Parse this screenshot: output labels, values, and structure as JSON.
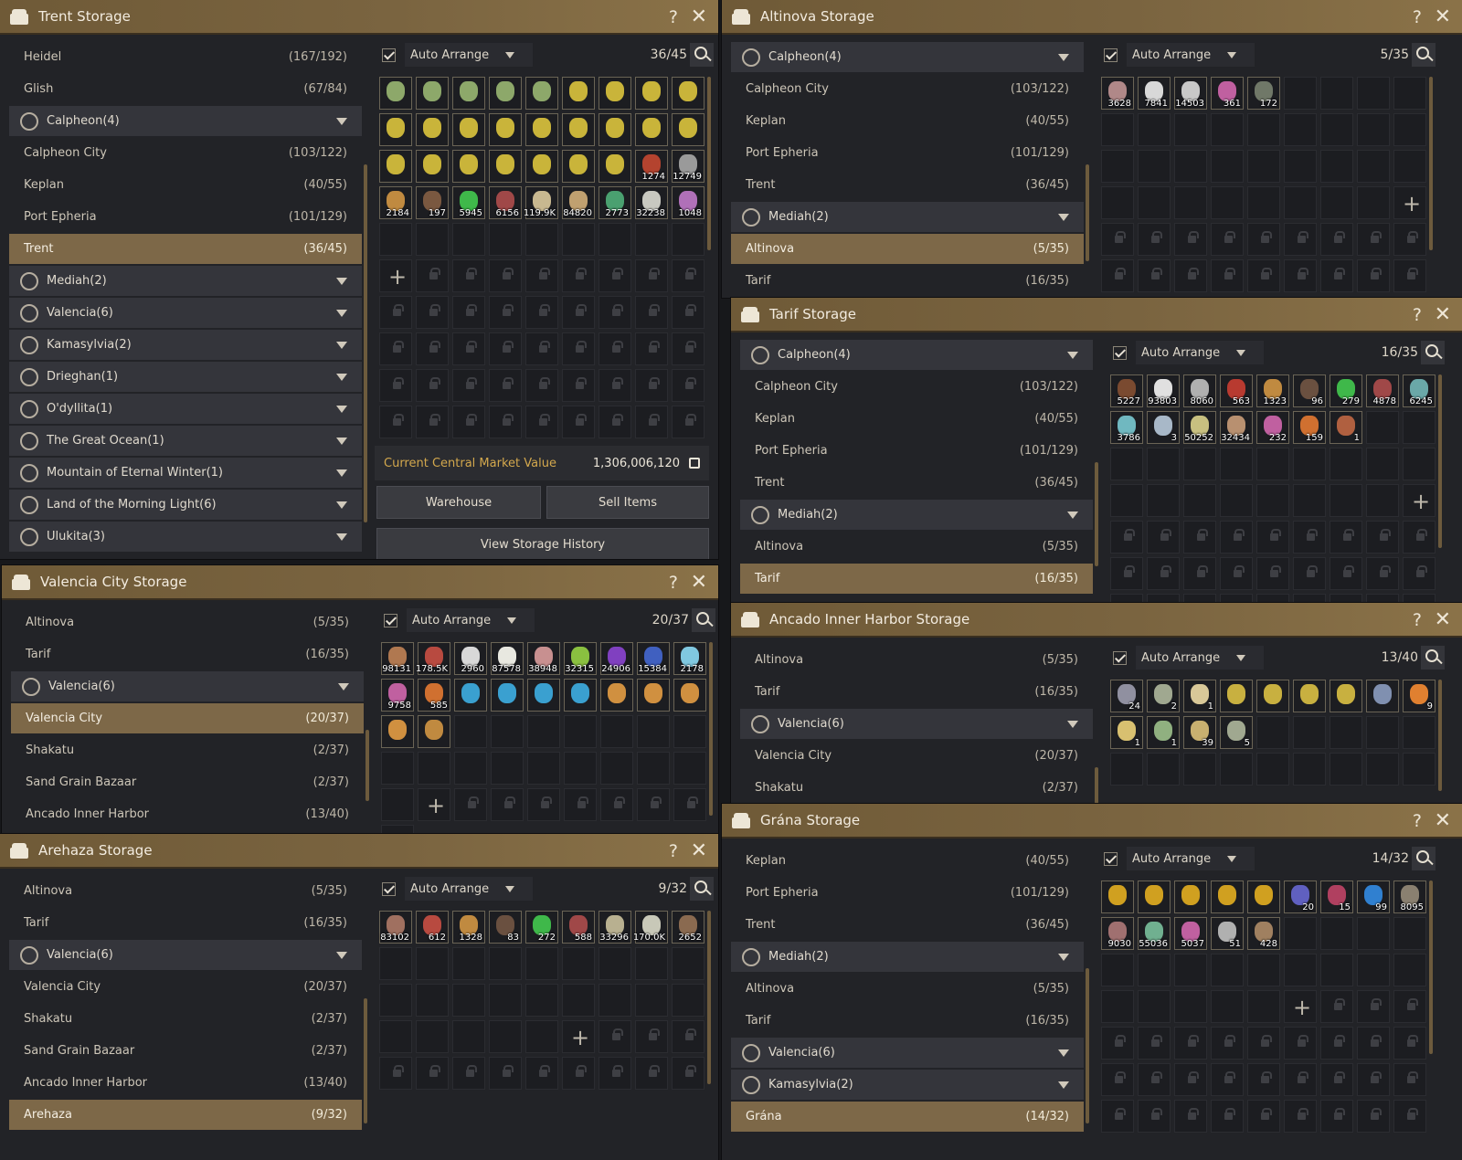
{
  "colors": {
    "accent_gold": "#7d6848",
    "market_label": "#d3a84d"
  },
  "panels": [
    {
      "title": "Trent Storage",
      "help": "?",
      "close": "✕",
      "scroll_top": true,
      "locations": [
        {
          "kind": "loc",
          "name": "Heidel",
          "count": "(167/192)"
        },
        {
          "kind": "loc",
          "name": "Glish",
          "count": "(67/84)"
        },
        {
          "kind": "region",
          "name": "Calpheon(4)",
          "icon": "calpheon-icon"
        },
        {
          "kind": "loc",
          "name": "Calpheon City",
          "count": "(103/122)"
        },
        {
          "kind": "loc",
          "name": "Keplan",
          "count": "(40/55)"
        },
        {
          "kind": "loc",
          "name": "Port Epheria",
          "count": "(101/129)"
        },
        {
          "kind": "sel",
          "name": "Trent",
          "count": "(36/45)"
        },
        {
          "kind": "region",
          "name": "Mediah(2)",
          "icon": "mediah-icon"
        },
        {
          "kind": "region",
          "name": "Valencia(6)",
          "icon": "valencia-icon"
        },
        {
          "kind": "region",
          "name": "Kamasylvia(2)",
          "icon": "kamasylvia-icon"
        },
        {
          "kind": "region",
          "name": "Drieghan(1)",
          "icon": "drieghan-icon"
        },
        {
          "kind": "region",
          "name": "O'dyllita(1)",
          "icon": "odyllita-icon"
        },
        {
          "kind": "region",
          "name": "The Great Ocean(1)",
          "icon": "great-ocean-icon"
        },
        {
          "kind": "region",
          "name": "Mountain of Eternal Winter(1)",
          "icon": "eternal-winter-icon"
        },
        {
          "kind": "region",
          "name": "Land of the Morning Light(6)",
          "icon": "morning-light-icon"
        },
        {
          "kind": "region",
          "name": "Ulukita(3)",
          "icon": "ulukita-icon"
        }
      ],
      "auto_arrange": "Auto Arrange",
      "capacity": "36/45",
      "items": [
        {
          "c": "#8da86a"
        },
        {
          "c": "#8da86a"
        },
        {
          "c": "#8da86a"
        },
        {
          "c": "#8da86a"
        },
        {
          "c": "#8da86a"
        },
        {
          "c": "#c9b43a"
        },
        {
          "c": "#c9b43a"
        },
        {
          "c": "#c9b43a"
        },
        {
          "c": "#c9b43a"
        },
        {
          "c": "#c9b43a"
        },
        {
          "c": "#c9b43a"
        },
        {
          "c": "#c9b43a"
        },
        {
          "c": "#c9b43a"
        },
        {
          "c": "#c9b43a"
        },
        {
          "c": "#c9b43a"
        },
        {
          "c": "#c9b43a"
        },
        {
          "c": "#c9b43a"
        },
        {
          "c": "#c9b43a"
        },
        {
          "c": "#c9b43a"
        },
        {
          "c": "#c9b43a"
        },
        {
          "c": "#c9b43a"
        },
        {
          "c": "#c9b43a"
        },
        {
          "c": "#c9b43a"
        },
        {
          "c": "#c9b43a"
        },
        {
          "c": "#c9b43a"
        },
        {
          "c": "#b4432f",
          "q": "1274"
        },
        {
          "c": "#9a9a9a",
          "q": "12749"
        },
        {
          "c": "#c08a40",
          "q": "2184"
        },
        {
          "c": "#7a5840",
          "q": "197"
        },
        {
          "c": "#3fb84a",
          "q": "5945"
        },
        {
          "c": "#a04848",
          "q": "6156"
        },
        {
          "c": "#c8b890",
          "q": "119.9K"
        },
        {
          "c": "#c0a070",
          "q": "84820"
        },
        {
          "c": "#4aa070",
          "q": "2773"
        },
        {
          "c": "#c8c8c0",
          "q": "32238"
        },
        {
          "c": "#b070b8",
          "q": "1048"
        }
      ],
      "empty": 9,
      "plus": 1,
      "locked": 44,
      "market_label": "Current Central Market Value",
      "market_value": "1,306,006,120",
      "warehouse_btn": "Warehouse",
      "sell_btn": "Sell Items",
      "history_btn": "View Storage History"
    },
    {
      "title": "Altinova Storage",
      "help": "?",
      "close": "✕",
      "locations": [
        {
          "kind": "region",
          "name": "Calpheon(4)",
          "icon": "calpheon-icon"
        },
        {
          "kind": "loc",
          "name": "Calpheon City",
          "count": "(103/122)"
        },
        {
          "kind": "loc",
          "name": "Keplan",
          "count": "(40/55)"
        },
        {
          "kind": "loc",
          "name": "Port Epheria",
          "count": "(101/129)"
        },
        {
          "kind": "loc",
          "name": "Trent",
          "count": "(36/45)"
        },
        {
          "kind": "region",
          "name": "Mediah(2)",
          "icon": "mediah-icon"
        },
        {
          "kind": "sel",
          "name": "Altinova",
          "count": "(5/35)"
        },
        {
          "kind": "loc",
          "name": "Tarif",
          "count": "(16/35)"
        }
      ],
      "auto_arrange": "Auto Arrange",
      "capacity": "5/35",
      "items": [
        {
          "c": "#b08888",
          "q": "3628"
        },
        {
          "c": "#d8d8d8",
          "q": "7841"
        },
        {
          "c": "#c8c8c8",
          "q": "14503"
        },
        {
          "c": "#c060a0",
          "q": "361"
        },
        {
          "c": "#707868",
          "q": "172"
        }
      ],
      "empty": 30,
      "plus": 1,
      "locked": 18
    },
    {
      "title": "Tarif Storage",
      "help": "?",
      "close": "✕",
      "locations": [
        {
          "kind": "region",
          "name": "Calpheon(4)",
          "icon": "calpheon-icon"
        },
        {
          "kind": "loc",
          "name": "Calpheon City",
          "count": "(103/122)"
        },
        {
          "kind": "loc",
          "name": "Keplan",
          "count": "(40/55)"
        },
        {
          "kind": "loc",
          "name": "Port Epheria",
          "count": "(101/129)"
        },
        {
          "kind": "loc",
          "name": "Trent",
          "count": "(36/45)"
        },
        {
          "kind": "region",
          "name": "Mediah(2)",
          "icon": "mediah-icon"
        },
        {
          "kind": "loc",
          "name": "Altinova",
          "count": "(5/35)"
        },
        {
          "kind": "sel",
          "name": "Tarif",
          "count": "(16/35)"
        }
      ],
      "auto_arrange": "Auto Arrange",
      "capacity": "16/35",
      "items": [
        {
          "c": "#7a4a30",
          "q": "5227"
        },
        {
          "c": "#e0e0e0",
          "q": "93803"
        },
        {
          "c": "#b0b0b0",
          "q": "8060"
        },
        {
          "c": "#b83a30",
          "q": "563"
        },
        {
          "c": "#c08a40",
          "q": "1323"
        },
        {
          "c": "#6a5040",
          "q": "96"
        },
        {
          "c": "#3fb84a",
          "q": "279"
        },
        {
          "c": "#a04848",
          "q": "4878"
        },
        {
          "c": "#6aa8a8",
          "q": "6245"
        },
        {
          "c": "#70b8c0",
          "q": "3786"
        },
        {
          "c": "#a8b8c8",
          "q": "3"
        },
        {
          "c": "#c8c080",
          "q": "50252"
        },
        {
          "c": "#b89070",
          "q": "32434"
        },
        {
          "c": "#c060a0",
          "q": "232"
        },
        {
          "c": "#d07030",
          "q": "159"
        },
        {
          "c": "#b06040",
          "q": "1"
        }
      ],
      "empty": 19,
      "plus": 1,
      "locked": 27
    },
    {
      "title": "Valencia City Storage",
      "help": "?",
      "close": "✕",
      "locations": [
        {
          "kind": "loc",
          "name": "Altinova",
          "count": "(5/35)"
        },
        {
          "kind": "loc",
          "name": "Tarif",
          "count": "(16/35)"
        },
        {
          "kind": "region",
          "name": "Valencia(6)",
          "icon": "valencia-icon"
        },
        {
          "kind": "sel",
          "name": "Valencia City",
          "count": "(20/37)"
        },
        {
          "kind": "loc",
          "name": "Shakatu",
          "count": "(2/37)"
        },
        {
          "kind": "loc",
          "name": "Sand Grain Bazaar",
          "count": "(2/37)"
        },
        {
          "kind": "loc",
          "name": "Ancado Inner Harbor",
          "count": "(13/40)"
        }
      ],
      "auto_arrange": "Auto Arrange",
      "capacity": "20/37",
      "items": [
        {
          "c": "#b07850",
          "q": "98131"
        },
        {
          "c": "#b84a40",
          "q": "178.5K"
        },
        {
          "c": "#d8d8d8",
          "q": "2960"
        },
        {
          "c": "#e8e8e0",
          "q": "87578"
        },
        {
          "c": "#c89090",
          "q": "38948"
        },
        {
          "c": "#8ac040",
          "q": "32315"
        },
        {
          "c": "#8040c0",
          "q": "24906"
        },
        {
          "c": "#4060c0",
          "q": "15384"
        },
        {
          "c": "#80c8e0",
          "q": "2178"
        },
        {
          "c": "#c060a0",
          "q": "9758"
        },
        {
          "c": "#d07030",
          "q": "585"
        },
        {
          "c": "#3aa0d0"
        },
        {
          "c": "#3aa0d0"
        },
        {
          "c": "#3aa0d0"
        },
        {
          "c": "#3aa0d0"
        },
        {
          "c": "#d09040"
        },
        {
          "c": "#d09040"
        },
        {
          "c": "#d09040"
        },
        {
          "c": "#d09040"
        },
        {
          "c": "#c08a40"
        }
      ],
      "empty": 17,
      "plus": 1,
      "locked": 8
    },
    {
      "title": "Ancado Inner Harbor Storage",
      "help": "?",
      "close": "✕",
      "locations": [
        {
          "kind": "loc",
          "name": "Altinova",
          "count": "(5/35)"
        },
        {
          "kind": "loc",
          "name": "Tarif",
          "count": "(16/35)"
        },
        {
          "kind": "region",
          "name": "Valencia(6)",
          "icon": "valencia-icon"
        },
        {
          "kind": "loc",
          "name": "Valencia City",
          "count": "(20/37)"
        },
        {
          "kind": "loc",
          "name": "Shakatu",
          "count": "(2/37)"
        }
      ],
      "auto_arrange": "Auto Arrange",
      "capacity": "13/40",
      "items": [
        {
          "c": "#9090a0",
          "q": "24"
        },
        {
          "c": "#a0a890",
          "q": "2"
        },
        {
          "c": "#d8c898",
          "q": "1"
        },
        {
          "c": "#c8b040"
        },
        {
          "c": "#c8b040"
        },
        {
          "c": "#c8b040"
        },
        {
          "c": "#c8b040"
        },
        {
          "c": "#8090b0"
        },
        {
          "c": "#e08030",
          "q": "9"
        },
        {
          "c": "#d8c070",
          "q": "1"
        },
        {
          "c": "#90b080",
          "q": "1"
        },
        {
          "c": "#c8b070",
          "q": "39"
        },
        {
          "c": "#a0a890",
          "q": "5"
        }
      ],
      "empty": 14,
      "plus": 0,
      "locked": 0
    },
    {
      "title": "Arehaza Storage",
      "help": "?",
      "close": "✕",
      "locations": [
        {
          "kind": "loc",
          "name": "Altinova",
          "count": "(5/35)"
        },
        {
          "kind": "loc",
          "name": "Tarif",
          "count": "(16/35)"
        },
        {
          "kind": "region",
          "name": "Valencia(6)",
          "icon": "valencia-icon"
        },
        {
          "kind": "loc",
          "name": "Valencia City",
          "count": "(20/37)"
        },
        {
          "kind": "loc",
          "name": "Shakatu",
          "count": "(2/37)"
        },
        {
          "kind": "loc",
          "name": "Sand Grain Bazaar",
          "count": "(2/37)"
        },
        {
          "kind": "loc",
          "name": "Ancado Inner Harbor",
          "count": "(13/40)"
        },
        {
          "kind": "sel",
          "name": "Arehaza",
          "count": "(9/32)"
        }
      ],
      "auto_arrange": "Auto Arrange",
      "capacity": "9/32",
      "items": [
        {
          "c": "#a07060",
          "q": "83102"
        },
        {
          "c": "#b84a40",
          "q": "612"
        },
        {
          "c": "#c08a40",
          "q": "1328"
        },
        {
          "c": "#6a5040",
          "q": "83"
        },
        {
          "c": "#3fb84a",
          "q": "272"
        },
        {
          "c": "#a04848",
          "q": "588"
        },
        {
          "c": "#b8b090",
          "q": "33296"
        },
        {
          "c": "#c8c8b8",
          "q": "170.0K"
        },
        {
          "c": "#8a6a50",
          "q": "2652"
        }
      ],
      "empty": 23,
      "plus": 1,
      "locked": 12
    },
    {
      "title": "Grána Storage",
      "help": "?",
      "close": "✕",
      "locations": [
        {
          "kind": "loc",
          "name": "Keplan",
          "count": "(40/55)"
        },
        {
          "kind": "loc",
          "name": "Port Epheria",
          "count": "(101/129)"
        },
        {
          "kind": "loc",
          "name": "Trent",
          "count": "(36/45)"
        },
        {
          "kind": "region",
          "name": "Mediah(2)",
          "icon": "mediah-icon"
        },
        {
          "kind": "loc",
          "name": "Altinova",
          "count": "(5/35)"
        },
        {
          "kind": "loc",
          "name": "Tarif",
          "count": "(16/35)"
        },
        {
          "kind": "region",
          "name": "Valencia(6)",
          "icon": "valencia-icon"
        },
        {
          "kind": "region",
          "name": "Kamasylvia(2)",
          "icon": "kamasylvia-icon"
        },
        {
          "kind": "sel",
          "name": "Grána",
          "count": "(14/32)"
        }
      ],
      "auto_arrange": "Auto Arrange",
      "capacity": "14/32",
      "items": [
        {
          "c": "#d0a020"
        },
        {
          "c": "#d0a020"
        },
        {
          "c": "#d0a020"
        },
        {
          "c": "#d0a020"
        },
        {
          "c": "#d0a020"
        },
        {
          "c": "#6060c0",
          "q": "20"
        },
        {
          "c": "#b04060",
          "q": "15"
        },
        {
          "c": "#3080d0",
          "q": "99"
        },
        {
          "c": "#8a8070",
          "q": "8095"
        },
        {
          "c": "#a07070",
          "q": "9030"
        },
        {
          "c": "#70b090",
          "q": "55036"
        },
        {
          "c": "#c060a0",
          "q": "5037"
        },
        {
          "c": "#b0b0b0",
          "q": "51"
        },
        {
          "c": "#a08060",
          "q": "428"
        }
      ],
      "empty": 18,
      "plus": 1,
      "locked": 30
    }
  ]
}
